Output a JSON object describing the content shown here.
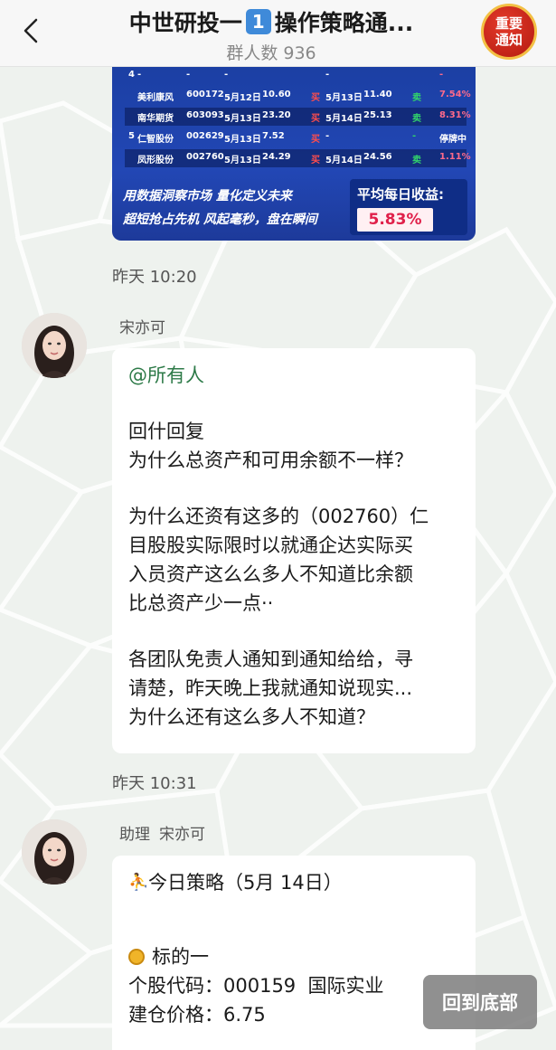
{
  "header": {
    "title_prefix": "中世研投一",
    "title_number": "1",
    "title_suffix": "操作策略通...",
    "member_count": "群人数 936",
    "notice_badge_line1": "重要",
    "notice_badge_line2": "通知"
  },
  "stock_image": {
    "rows": [
      {
        "idx": "4",
        "name": "-",
        "code": "-",
        "buy_date": "-",
        "buy_price": "",
        "tag1": "",
        "sell_date": "-",
        "sell_price": "",
        "tag2": "",
        "result": "-"
      },
      {
        "idx": "",
        "name": "美利康风",
        "code": "600172",
        "buy_date": "5月12日",
        "buy_price": "10.60",
        "tag1": "买",
        "sell_date": "5月13日",
        "sell_price": "11.40",
        "tag2": "卖",
        "result": "7.54%"
      },
      {
        "idx": "",
        "name": "南华期货",
        "code": "603093",
        "buy_date": "5月13日",
        "buy_price": "23.20",
        "tag1": "买",
        "sell_date": "5月14日",
        "sell_price": "25.13",
        "tag2": "卖",
        "result": "8.31%"
      },
      {
        "idx": "5",
        "name": "仁智股份",
        "code": "002629",
        "buy_date": "5月13日",
        "buy_price": "7.52",
        "tag1": "买",
        "sell_date": "-",
        "sell_price": "",
        "tag2": "-",
        "result": "停牌中"
      },
      {
        "idx": "",
        "name": "凤形股份",
        "code": "002760",
        "buy_date": "5月13日",
        "buy_price": "24.29",
        "tag1": "买",
        "sell_date": "5月14日",
        "sell_price": "24.56",
        "tag2": "卖",
        "result": "1.11%"
      }
    ],
    "slogan_line1": "用数据洞察市场 量化定义未来",
    "slogan_line2": "超短抢占先机 风起毫秒，盘在瞬间",
    "avg_label": "平均每日收益:",
    "avg_value": "5.83%"
  },
  "messages": [
    {
      "timestamp": "昨天 10:20",
      "sender": [
        "宋亦可"
      ],
      "mention": "@所有人",
      "paragraphs": [
        "回什回复\n为什么总资产和可用余额不一样？",
        "为什么还资有这多的（002760）仁\n目股股实际限时以就通企达实际买\n入员资产这么么多人不知道比余额\n比总资产少一点··",
        "各团队免责人通知到通知给给，寻\n请楚，昨天晚上我就通知说现实...\n为什么还有这么多人不知道？"
      ]
    },
    {
      "timestamp": "昨天 10:31",
      "sender": [
        "助理",
        "宋亦可"
      ],
      "strategy_title": "今日策略（5月 14日）",
      "target_label": "标的一",
      "lines": [
        "个股代码：000159  国际实业",
        "建仓价格：6.75"
      ]
    }
  ],
  "jump_button": "回到底部",
  "colors": {
    "header_bg": "#f7f7f7",
    "chat_bg": "#eef2ee",
    "mention": "#2d7a48",
    "badge_blue": "#3f8ad9",
    "notice_red": "#c7261a"
  }
}
